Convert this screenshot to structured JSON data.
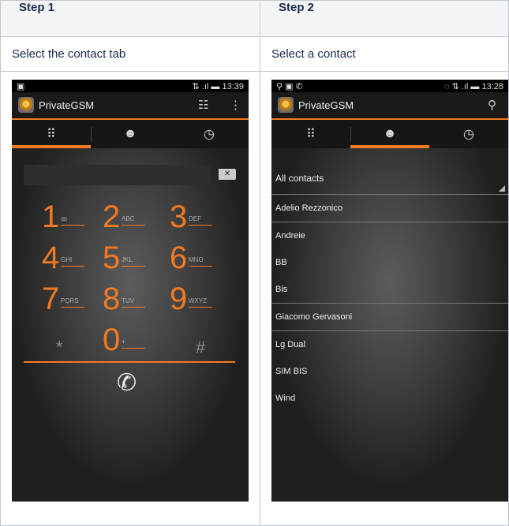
{
  "steps": [
    {
      "header": "Step 1",
      "caption": "Select the contact tab"
    },
    {
      "header": "Step 2",
      "caption": "Select a contact"
    }
  ],
  "phone1": {
    "status_left": "▣",
    "status_right": "⇅ .ıl ▬ 13:39",
    "app_title": "PrivateGSM",
    "keypad": [
      {
        "digit": "1",
        "letters": "ꝏ"
      },
      {
        "digit": "2",
        "letters": "ABC"
      },
      {
        "digit": "3",
        "letters": "DEF"
      },
      {
        "digit": "4",
        "letters": "GHI"
      },
      {
        "digit": "5",
        "letters": "JKL"
      },
      {
        "digit": "6",
        "letters": "MNO"
      },
      {
        "digit": "7",
        "letters": "PQRS"
      },
      {
        "digit": "8",
        "letters": "TUV"
      },
      {
        "digit": "9",
        "letters": "WXYZ"
      },
      {
        "digit": "*",
        "letters": ""
      },
      {
        "digit": "0",
        "letters": "+"
      },
      {
        "digit": "#",
        "letters": ""
      }
    ]
  },
  "phone2": {
    "status_left": "⚲ ▣ ✆",
    "status_right": "◌ ⇅ .ıl ▬ 13:28",
    "app_title": "PrivateGSM",
    "dropdown": "All contacts",
    "contacts": [
      "Adelio Rezzonico",
      "Andreie",
      "BB",
      "Bis",
      "Giacomo Gervasoni",
      "Lg Dual",
      "SIM BIS",
      "Wind"
    ]
  },
  "icons": {
    "dialpad": "dialpad-icon",
    "contacts": "contacts-icon",
    "history": "clock-icon",
    "settings": "settings-icon",
    "menu": "overflow-menu-icon",
    "search": "search-icon",
    "call": "phone-icon",
    "backspace": "backspace-icon"
  },
  "colors": {
    "accent": "#f47a20",
    "header_bg": "#f4f5f7",
    "border": "#c1c7d0"
  }
}
